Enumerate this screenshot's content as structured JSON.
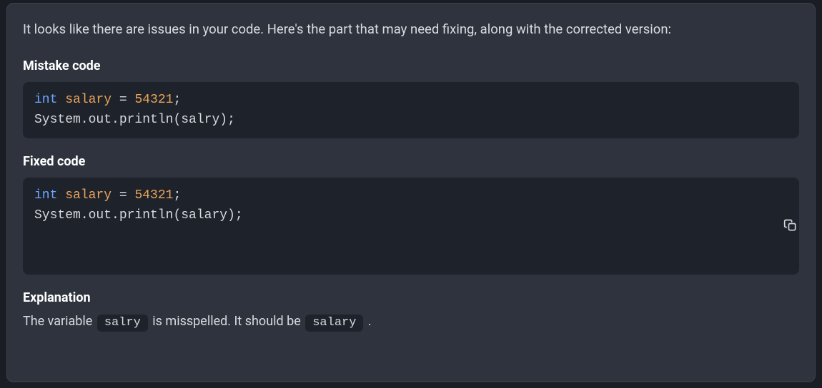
{
  "intro": "It looks like there are issues in your code. Here's the part that may need fixing, along with the corrected version:",
  "sections": {
    "mistake": {
      "title": "Mistake code",
      "code": {
        "line1": {
          "kw": "int",
          "var": "salary",
          "eq": " = ",
          "num": "54321",
          "semi": ";"
        },
        "line2": {
          "call": "System.out.println",
          "open": "(",
          "arg": "salry",
          "close": ")",
          "semi": ";"
        }
      }
    },
    "fixed": {
      "title": "Fixed code",
      "code": {
        "line1": {
          "kw": "int",
          "var": "salary",
          "eq": " = ",
          "num": "54321",
          "semi": ";"
        },
        "line2": {
          "call": "System.out.println",
          "open": "(",
          "arg": "salary",
          "close": ")",
          "semi": ";"
        }
      }
    },
    "explanation": {
      "title": "Explanation",
      "parts": {
        "p1": "The variable ",
        "code1": "salry",
        "p2": " is misspelled. It should be ",
        "code2": "salary",
        "p3": " ."
      }
    }
  }
}
